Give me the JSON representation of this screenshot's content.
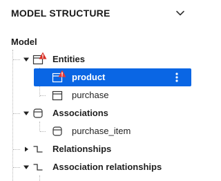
{
  "header": {
    "title": "MODEL STRUCTURE",
    "collapse_icon": "chevron-down-icon"
  },
  "tree": {
    "root_label": "Model",
    "nodes": [
      {
        "label": "Entities",
        "expanded": true,
        "icon": "entity-table-icon",
        "warning": true
      },
      {
        "label": "product",
        "selected": true,
        "icon": "entity-table-icon",
        "warning": true
      },
      {
        "label": "purchase",
        "icon": "entity-table-icon"
      },
      {
        "label": "Associations",
        "expanded": true,
        "icon": "association-icon"
      },
      {
        "label": "purchase_item",
        "icon": "association-icon"
      },
      {
        "label": "Relationships",
        "expanded": false,
        "icon": "relationship-icon"
      },
      {
        "label": "Association relationships",
        "expanded": true,
        "icon": "relationship-icon"
      }
    ]
  },
  "colors": {
    "selection": "#0a66e4",
    "warning": "#d93025",
    "text": "#1f1f1f",
    "guide": "#b5b5b5"
  }
}
